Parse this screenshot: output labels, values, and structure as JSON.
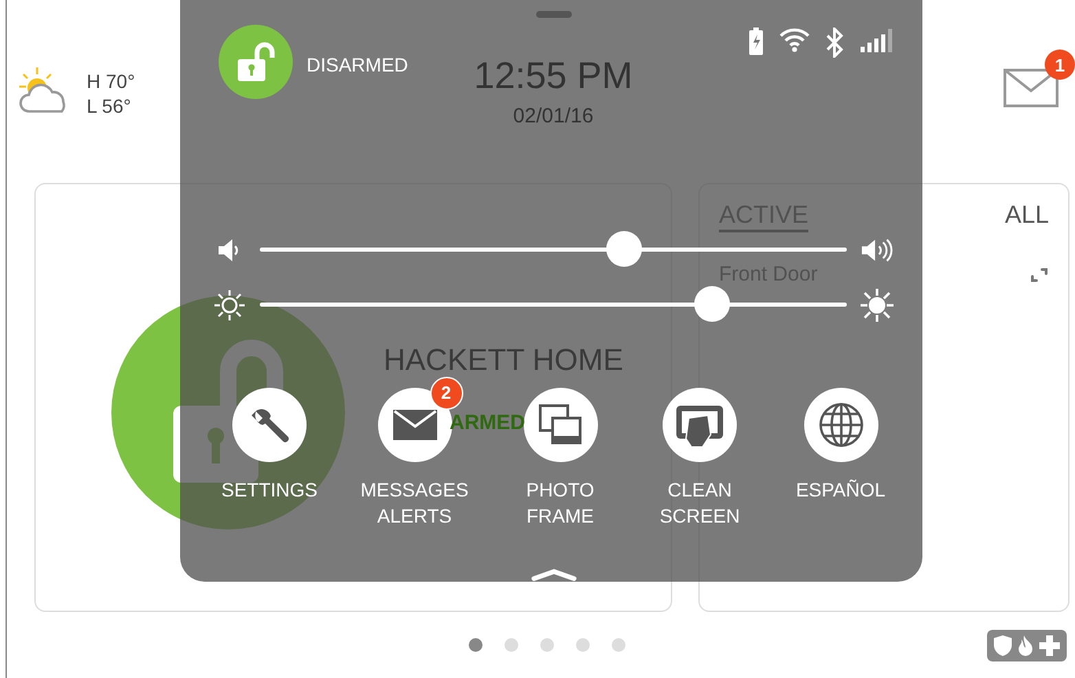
{
  "weather": {
    "high": "H 70°",
    "low": "L 56°"
  },
  "messages": {
    "badge": "1"
  },
  "partition": {
    "title": "HACKETT HOME",
    "status": "ARMED"
  },
  "sensor_card": {
    "tabs": [
      {
        "label": "ACTIVE",
        "selected": true
      },
      {
        "label": "ALL",
        "selected": false
      }
    ],
    "sensors": [
      {
        "name": "Front Door"
      }
    ]
  },
  "page_dots": [
    {
      "selected": true
    },
    {
      "selected": false
    },
    {
      "selected": false
    },
    {
      "selected": false
    },
    {
      "selected": false
    }
  ],
  "panel": {
    "status": "DISARMED",
    "time": "12:55 PM",
    "date": "02/01/16",
    "sliders": [
      {
        "kind": "volume",
        "level": 0.62
      },
      {
        "kind": "brightness",
        "level": 0.77
      }
    ],
    "shortcuts": [
      {
        "kind": "settings",
        "label": "SETTINGS"
      },
      {
        "kind": "messages",
        "label": "MESSAGES ALERTS",
        "badge": "2"
      },
      {
        "kind": "photo",
        "label": "PHOTO FRAME"
      },
      {
        "kind": "clean",
        "label": "CLEAN SCREEN"
      },
      {
        "kind": "language",
        "label": "ESPAÑOL"
      }
    ]
  }
}
